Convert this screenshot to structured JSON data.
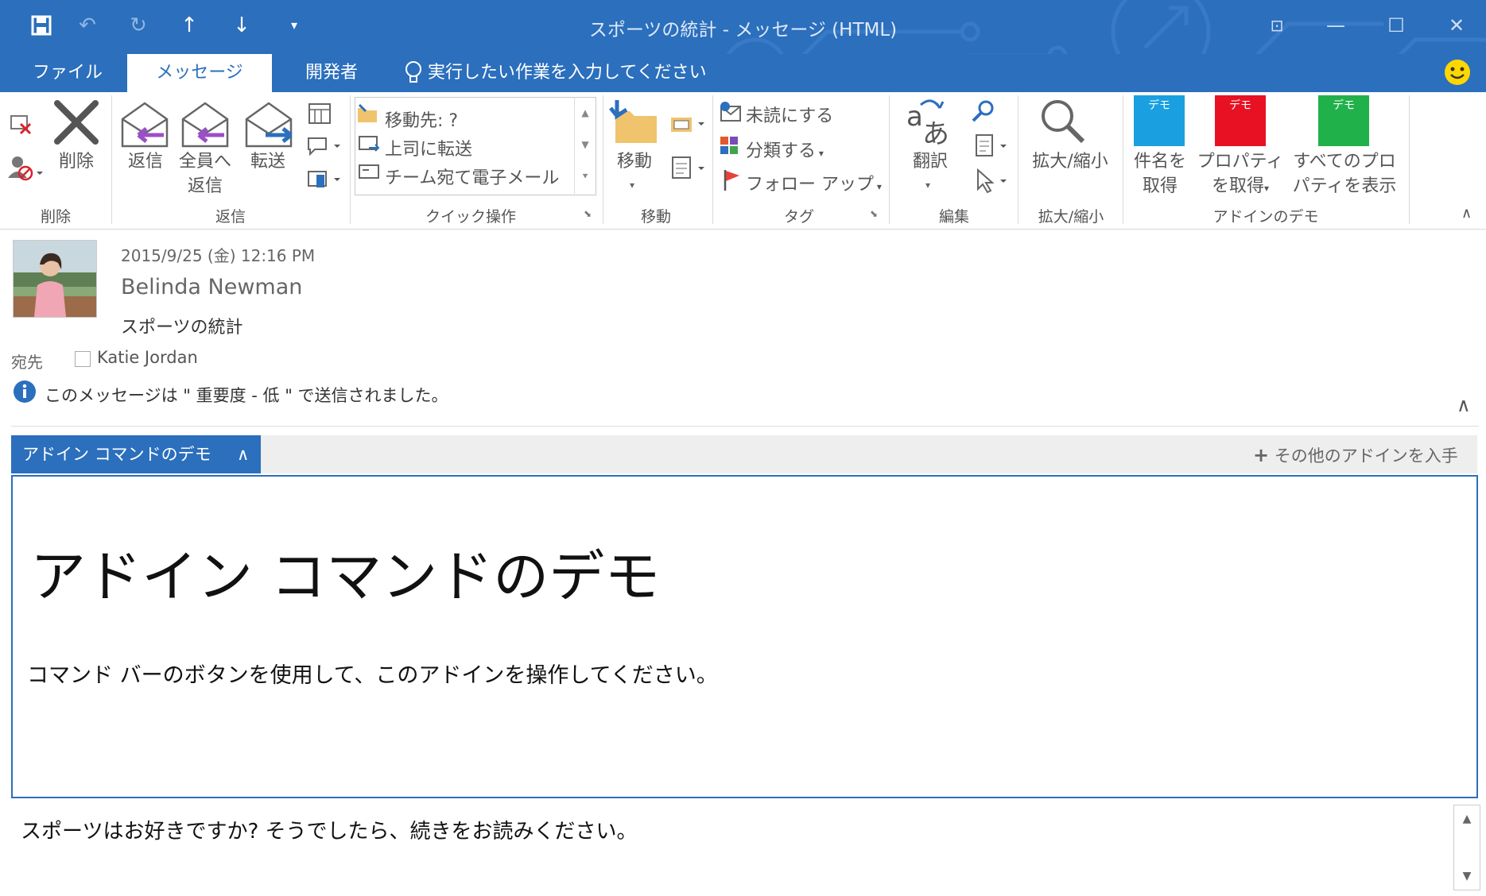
{
  "window": {
    "title": "スポーツの統計 - メッセージ (HTML)",
    "accent_color": "#2b6fbd",
    "quick_access": [
      "save-icon",
      "undo-icon",
      "redo-icon",
      "up-arrow-icon",
      "down-arrow-icon",
      "customize-icon"
    ],
    "controls": [
      "restore-ribbon-icon",
      "minimize-icon",
      "maximize-icon",
      "close-icon"
    ]
  },
  "tabs": {
    "file": "ファイル",
    "message": "メッセージ",
    "developer": "開発者",
    "tell_me": "実行したい作業を入力してください"
  },
  "ribbon": {
    "delete_group": {
      "label": "削除",
      "delete_button": "削除"
    },
    "reply_group": {
      "label": "返信",
      "reply": "返信",
      "reply_all_1": "全員へ",
      "reply_all_2": "返信",
      "forward": "転送"
    },
    "quick_steps": {
      "label": "クイック操作",
      "items": [
        "移動先: ?",
        "上司に転送",
        "チーム宛て電子メール"
      ]
    },
    "move_group": {
      "label": "移動",
      "move": "移動"
    },
    "tags_group": {
      "label": "タグ",
      "unread": "未読にする",
      "categorize": "分類する",
      "follow_up": "フォロー アップ"
    },
    "edit_group": {
      "label": "編集",
      "translate": "翻訳"
    },
    "zoom_group": {
      "label": "拡大/縮小",
      "zoom": "拡大/縮小"
    },
    "addin_group": {
      "label": "アドインのデモ",
      "tile_text": "デモ",
      "get_subject_1": "件名を",
      "get_subject_2": "取得",
      "get_props_1": "プロパティ",
      "get_props_2": "を取得",
      "show_all_1": "すべてのプロ",
      "show_all_2": "パティを表示",
      "colors": [
        "#1aa0e0",
        "#e81123",
        "#21b14b"
      ]
    }
  },
  "message": {
    "datetime": "2015/9/25 (金) 12:16 PM",
    "sender": "Belinda Newman",
    "subject": "スポーツの統計",
    "to_label": "宛先",
    "to": "Katie Jordan",
    "info": "このメッセージは \" 重要度 - 低 \" で送信されました。"
  },
  "addin_bar": {
    "tab_label": "アドイン コマンドのデモ",
    "get_more": "その他のアドインを入手",
    "heading": "アドイン コマンドのデモ",
    "body": "コマンド バーのボタンを使用して、このアドインを操作してください。"
  },
  "body_text": "スポーツはお好きですか? そうでしたら、続きをお読みください。"
}
